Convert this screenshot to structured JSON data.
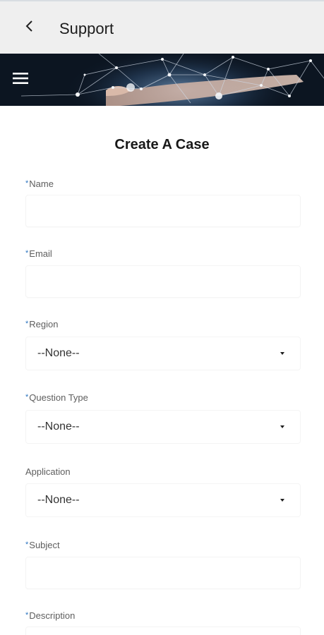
{
  "app_bar": {
    "title": "Support",
    "back_icon": "chevron-left-icon"
  },
  "banner": {
    "menu_icon": "hamburger-menu-icon",
    "image": "network-hand-banner"
  },
  "form": {
    "heading": "Create A Case",
    "required_marker": "*",
    "required_color": "#2b74c0",
    "fields": {
      "name": {
        "label": "Name",
        "required": true,
        "value": ""
      },
      "email": {
        "label": "Email",
        "required": true,
        "value": ""
      },
      "region": {
        "label": "Region",
        "required": true,
        "selected": "--None--"
      },
      "question_type": {
        "label": "Question Type",
        "required": true,
        "selected": "--None--"
      },
      "application": {
        "label": "Application",
        "required": false,
        "selected": "--None--"
      },
      "subject": {
        "label": "Subject",
        "required": true,
        "value": ""
      },
      "description": {
        "label": "Description",
        "required": true,
        "value": ""
      }
    }
  }
}
